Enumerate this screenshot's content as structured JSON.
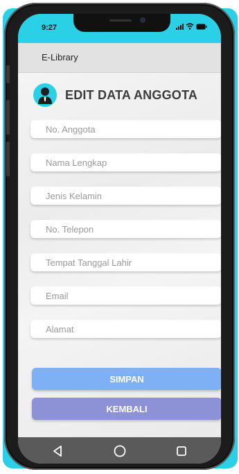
{
  "status_bar": {
    "time": "9:27",
    "icons": [
      "signal-icon",
      "wifi-icon",
      "battery-icon"
    ]
  },
  "header": {
    "app_title": "E-Library"
  },
  "page": {
    "title": "EDIT DATA ANGGOTA",
    "icon": "user-avatar-icon"
  },
  "form": {
    "fields": [
      {
        "name": "no-anggota-input",
        "placeholder": "No. Anggota",
        "value": ""
      },
      {
        "name": "nama-lengkap-input",
        "placeholder": "Nama Lengkap",
        "value": ""
      },
      {
        "name": "jenis-kelamin-input",
        "placeholder": "Jenis Kelamin",
        "value": ""
      },
      {
        "name": "no-telepon-input",
        "placeholder": "No. Telepon",
        "value": ""
      },
      {
        "name": "tempat-tanggal-lahir-input",
        "placeholder": "Tempat Tanggal Lahir",
        "value": ""
      },
      {
        "name": "email-input",
        "placeholder": "Email",
        "value": ""
      },
      {
        "name": "alamat-input",
        "placeholder": "Alamat",
        "value": ""
      }
    ]
  },
  "buttons": {
    "save_label": "SIMPAN",
    "back_label": "KEMBALI"
  },
  "nav_bar": {
    "icons": [
      "back-triangle-icon",
      "home-circle-icon",
      "recent-apps-square-icon"
    ]
  },
  "colors": {
    "accent_cyan": "#2ad1e6",
    "save_button": "#7eb0f6",
    "back_button": "#8d92d6",
    "nav_bar": "#5a5a5a"
  }
}
